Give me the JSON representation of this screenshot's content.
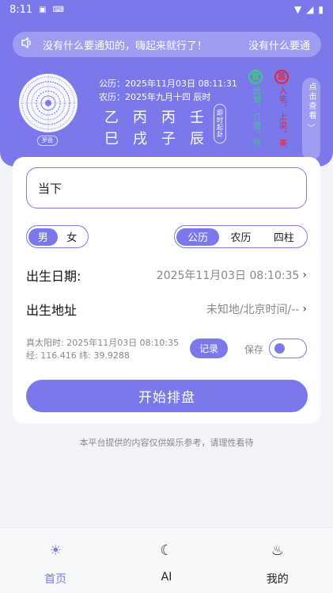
{
  "status_bar": {
    "time": "8:11",
    "icons": [
      "notification-a-icon",
      "keyboard-icon",
      "wifi-icon",
      "signal-icon",
      "battery-icon"
    ]
  },
  "notice": {
    "message": "没有什么要通知的，嗨起来就行了！",
    "message_repeat": "没有什么要通"
  },
  "compass": {
    "label": "罗盘"
  },
  "dates": {
    "solar": "公历：2025年11月03日 08:11:31",
    "lunar": "农历：2025年九月十四 辰时"
  },
  "pillars": {
    "heavenly": [
      "乙",
      "丙",
      "丙",
      "壬"
    ],
    "earthly": [
      "巳",
      "戌",
      "子",
      "辰"
    ]
  },
  "now_button": "即时起卦",
  "yi": {
    "badge": "宜",
    "text": "结婚、订盟、开"
  },
  "ji": {
    "badge": "忌",
    "text": "入宅、上梁、斋"
  },
  "click_view": {
    "label": "点击查看",
    "chevron": "﹀"
  },
  "name_input": {
    "value": "当下"
  },
  "gender": {
    "options": [
      "男",
      "女"
    ],
    "selected": "男"
  },
  "calendar": {
    "options": [
      "公历",
      "农历",
      "四柱"
    ],
    "selected": "公历"
  },
  "birth_date": {
    "label": "出生日期:",
    "value": "2025年11月03日 08:10:35",
    "arrow": "›"
  },
  "birth_place": {
    "label": "出生地址",
    "value": "未知地/北京时间/--",
    "arrow": "›"
  },
  "solar_time": {
    "line1": "真太阳时: 2025年11月03日 08:10:35",
    "line2": "经: 116.416 纬: 39.9288"
  },
  "record_button": "记录",
  "save": {
    "label": "保存",
    "on": false
  },
  "start_button": "开始排盘",
  "disclaimer": "本平台提供的内容仅供娱乐参考，请理性看待",
  "nav": {
    "items": [
      {
        "label": "首页",
        "icon": "sun-icon",
        "glyph": "☀",
        "active": true
      },
      {
        "label": "AI",
        "icon": "moon-icon",
        "glyph": "☾",
        "active": false
      },
      {
        "label": "我的",
        "icon": "flame-icon",
        "glyph": "♨",
        "active": false
      }
    ]
  },
  "colors": {
    "primary": "#7b78ec",
    "yi": "#3bd081",
    "ji": "#e8222e"
  }
}
